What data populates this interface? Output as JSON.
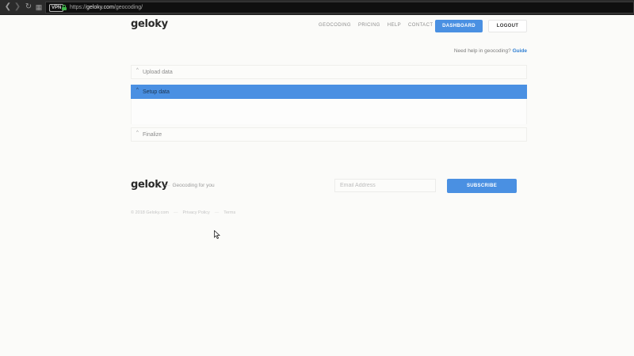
{
  "browser": {
    "vpn_badge": "VPN",
    "url_prefix": "https://",
    "url_host": "geloky.com",
    "url_path": "/geocoding/"
  },
  "header": {
    "logo": "geloky",
    "nav": [
      "GEOCODING",
      "PRICING",
      "HELP",
      "CONTACT"
    ],
    "dashboard_label": "DASHBOARD",
    "logout_label": "LOGOUT"
  },
  "help": {
    "text": "Need help in geocoding?",
    "link": "Guide"
  },
  "accordion": {
    "items": [
      {
        "label": "Upload data",
        "chevron": "^"
      },
      {
        "label": "Setup data",
        "chevron": "^"
      },
      {
        "label": "Finalize",
        "chevron": "^"
      }
    ],
    "active_color": "#4a90e2"
  },
  "footer": {
    "logo": "geloky",
    "tagline": "Geocoding for you",
    "email_placeholder": "Email Address",
    "subscribe_label": "SUBSCRIBE",
    "copyright": "© 2018 Geloky.com",
    "privacy": "Privacy Policy",
    "terms": "Terms"
  },
  "colors": {
    "accent": "#4a90e2",
    "link": "#2f7fd3",
    "lock": "#3fb54a"
  },
  "icons": [
    "back-arrow-icon",
    "forward-arrow-icon",
    "reload-icon",
    "grid-icon",
    "lock-icon",
    "chevron-up-icon",
    "mouse-cursor-icon"
  ]
}
